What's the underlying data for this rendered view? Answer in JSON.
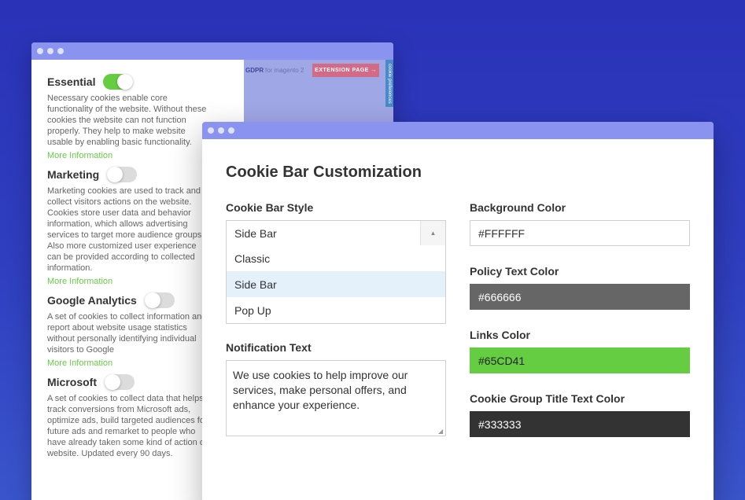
{
  "back_window": {
    "banner": {
      "gdpr": "GDPR",
      "for_text": "for magento 2",
      "extension_button": "EXTENSION PAGE →",
      "side_tab": "cookie preferences"
    },
    "groups": [
      {
        "title": "Essential",
        "enabled": true,
        "description": "Necessary cookies enable core functionality of the website. Without these cookies the website can not function properly. They help to make website usable by enabling basic functionality.",
        "more": "More Information"
      },
      {
        "title": "Marketing",
        "enabled": false,
        "description": "Marketing cookies are used to track and collect visitors actions on the website. Cookies store user data and behavior information, which allows advertising services to target more audience groups. Also more customized user experience can be provided according to collected information.",
        "more": "More Information"
      },
      {
        "title": "Google Analytics",
        "enabled": false,
        "description": "A set of cookies to collect information and report about website usage statistics without personally identifying individual visitors to Google",
        "more": "More Information"
      },
      {
        "title": "Microsoft",
        "enabled": false,
        "description": "A set of cookies to collect data that helps track conversions from Microsoft ads, optimize ads, build targeted audiences for future ads and remarket to people who have already taken some kind of action on website. Updated every 90 days.",
        "more": ""
      }
    ]
  },
  "front_window": {
    "title": "Cookie Bar Customization",
    "style_label": "Cookie Bar Style",
    "style_value": "Side Bar",
    "style_options": [
      "Classic",
      "Side Bar",
      "Pop Up"
    ],
    "notification_label": "Notification Text",
    "notification_text": "We use cookies to help improve our services, make personal offers, and enhance your experience.",
    "bg_label": "Background Color",
    "bg_value": "#FFFFFF",
    "policy_label": "Policy Text Color",
    "policy_value": "#666666",
    "links_label": "Links Color",
    "links_value": "#65CD41",
    "group_title_label": "Cookie Group Title Text Color",
    "group_title_value": "#333333"
  },
  "colors": {
    "accent_green": "#65CD41",
    "titlebar": "#8A93EF",
    "background_blue": "#2F3FC0"
  }
}
